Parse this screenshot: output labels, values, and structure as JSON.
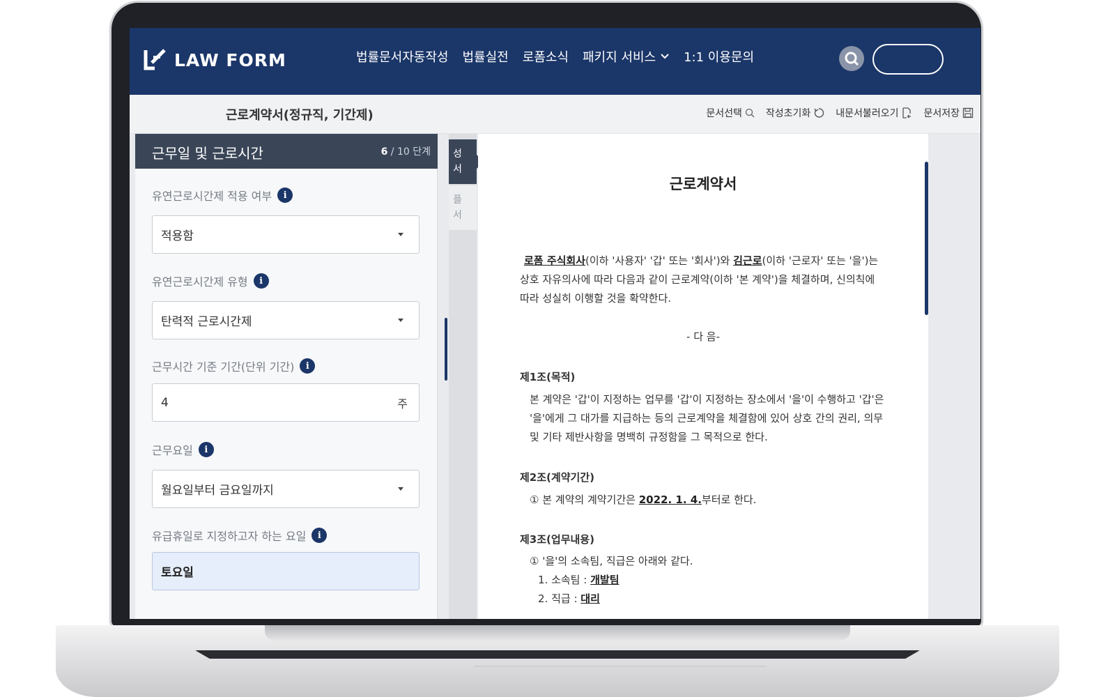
{
  "header": {
    "logo_text": "LAW FORM",
    "nav": [
      {
        "label": "법률문서자동작성"
      },
      {
        "label": "법률실전"
      },
      {
        "label": "로폼소식"
      },
      {
        "label": "패키지 서비스",
        "has_dropdown": true
      },
      {
        "label": "1:1 이용문의"
      }
    ]
  },
  "subbar": {
    "doc_title": "근로계약서(정규직, 기간제)",
    "tools": [
      {
        "label": "문서선택",
        "icon": "search-doc-icon"
      },
      {
        "label": "작성초기화",
        "icon": "reset-icon"
      },
      {
        "label": "내문서불러오기",
        "icon": "load-doc-icon"
      },
      {
        "label": "문서저장",
        "icon": "save-icon"
      }
    ]
  },
  "form": {
    "step_title": "근무일 및 근로시간",
    "step_current": "6",
    "step_total": " / 10 단계",
    "fields": [
      {
        "label": "유연근로시간제 적용 여부",
        "value": "적용함",
        "type": "select"
      },
      {
        "label": "유연근로시간제 유형",
        "value": "탄력적 근로시간제",
        "type": "select"
      },
      {
        "label": "근무시간 기준 기간(단위 기간)",
        "value": "4",
        "unit": "주",
        "type": "input"
      },
      {
        "label": "근무요일",
        "value": "월요일부터 금요일까지",
        "type": "select"
      },
      {
        "label": "유급휴일로 지정하고자 하는 요일",
        "value": "토요일",
        "type": "input-active"
      }
    ]
  },
  "tabs": {
    "tab1": "성\n서",
    "tab2": "플\n서"
  },
  "document": {
    "title": "근로계약서",
    "intro_company": "로폼 주식회사",
    "intro_part1": "(이하 '사용자' '갑' 또는 '회사')와 ",
    "intro_worker": "김근로",
    "intro_part2": "(이하 '근로자' 또는 '을')는",
    "intro_line2": "상호 자유의사에 따라 다음과 같이 근로계약(이하 '본 계약')을 체결하며, 신의칙에",
    "intro_line3": "따라 성실히 이행할 것을 확약한다.",
    "next": "- 다 음-",
    "art1_title": "제1조(목적)",
    "art1_line1": "본 계약은 '갑'이 지정하는 업무를 '갑'이 지정하는 장소에서 '을'이 수행하고 '갑'은",
    "art1_line2": "'을'에게 그 대가를 지급하는 등의 근로계약을 체결함에 있어 상호 간의 권리, 의무",
    "art1_line3": "및 기타 제반사항을 명백히 규정함을 그 목적으로 한다.",
    "art2_title": "제2조(계약기간)",
    "art2_pre": "① 본 계약의 계약기간은 ",
    "art2_date": "2022. 1. 4.",
    "art2_post": "부터로 한다.",
    "art3_title": "제3조(업무내용)",
    "art3_line1": "① '을'의 소속팀, 직급은 아래와 같다.",
    "art3_team_pre": "1. 소속팀 : ",
    "art3_team": "개발팀",
    "art3_rank_pre": "2. 직급 : ",
    "art3_rank": "대리"
  },
  "colors": {
    "header_bg": "#1b3668",
    "step_head_bg": "#3a4658",
    "active_field_bg": "#e6eefb"
  }
}
